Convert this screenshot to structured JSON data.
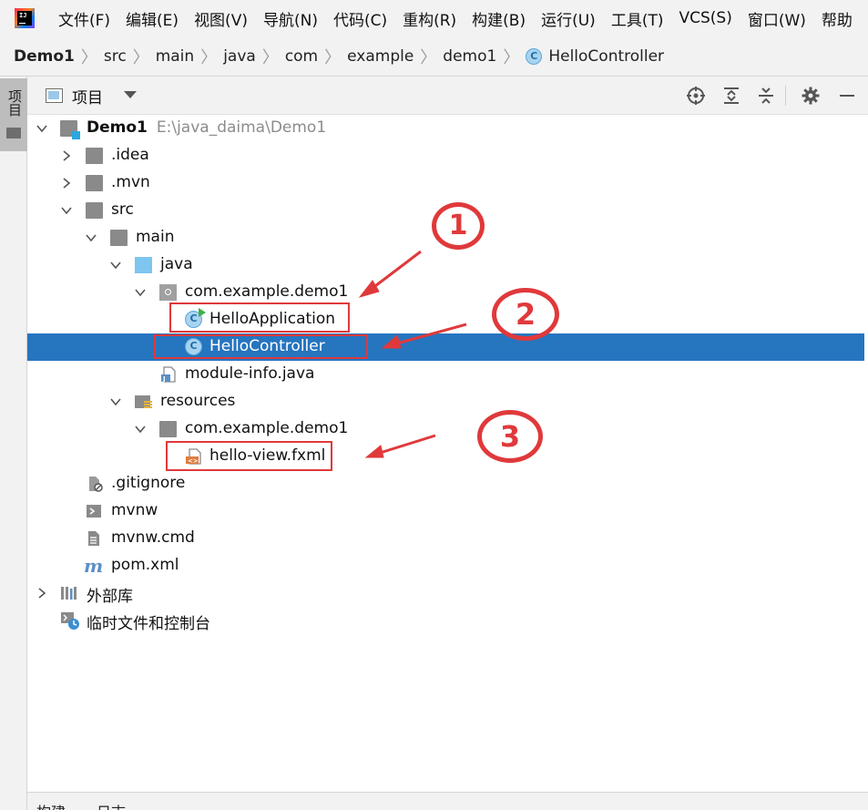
{
  "menubar": {
    "items": [
      "文件(F)",
      "编辑(E)",
      "视图(V)",
      "导航(N)",
      "代码(C)",
      "重构(R)",
      "构建(B)",
      "运行(U)",
      "工具(T)",
      "VCS(S)",
      "窗口(W)",
      "帮助"
    ]
  },
  "breadcrumb": [
    "Demo1",
    "src",
    "main",
    "java",
    "com",
    "example",
    "demo1",
    "HelloController"
  ],
  "tool_stripe": {
    "label": "项目"
  },
  "project_panel": {
    "title": "项目",
    "header_icons": [
      "locate-icon",
      "expand-all-icon",
      "collapse-all-icon",
      "settings-gear-icon",
      "minimize-icon"
    ]
  },
  "tree": {
    "demo1": "Demo1",
    "demo1_path": "E:\\java_daima\\Demo1",
    "idea": ".idea",
    "mvn": ".mvn",
    "src": "src",
    "main": "main",
    "java": "java",
    "pkg_java": "com.example.demo1",
    "hello_application": "HelloApplication",
    "hello_controller": "HelloController",
    "module_info": "module-info.java",
    "resources": "resources",
    "pkg_resources": "com.example.demo1",
    "hello_view": "hello-view.fxml",
    "gitignore": ".gitignore",
    "mvnw": "mvnw",
    "mvnw_cmd": "mvnw.cmd",
    "pom": "pom.xml",
    "external_libs": "外部库",
    "scratches": "临时文件和控制台"
  },
  "annotations": {
    "one": "①",
    "two": "②",
    "three": "③"
  },
  "bottom_bar": {
    "build": "构建",
    "log": "日志"
  },
  "colors": {
    "selection": "#2675bf",
    "annotation_red": "#e0393b"
  }
}
